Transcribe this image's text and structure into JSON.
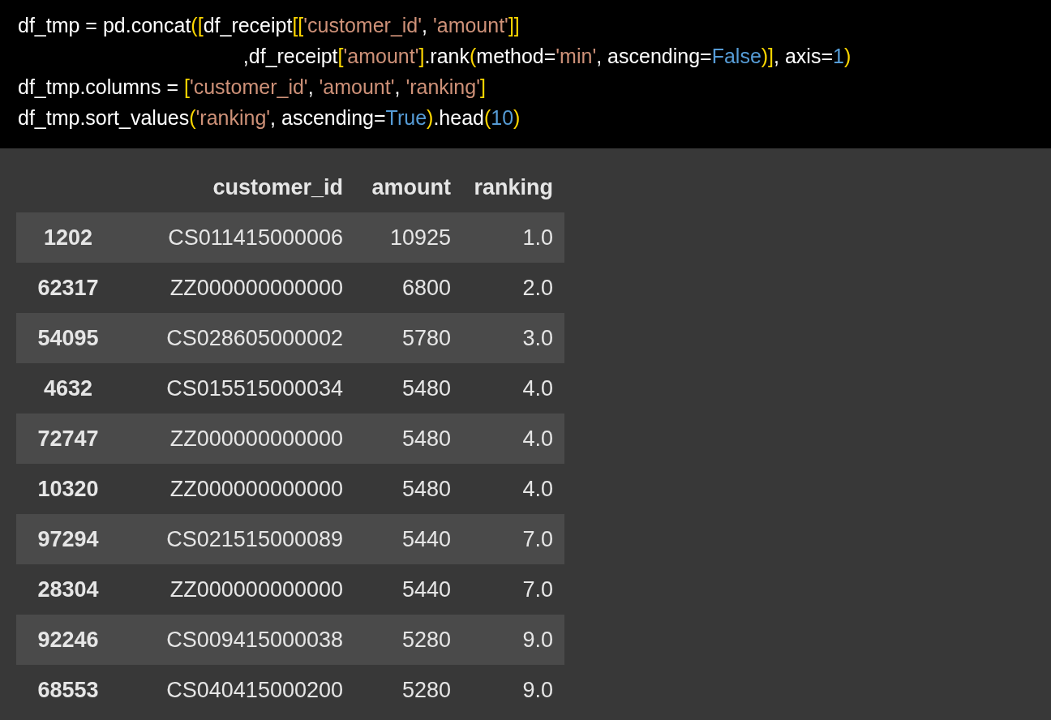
{
  "code_cell": {
    "lines": [
      {
        "tokens": [
          {
            "text": "df_tmp = pd.concat",
            "kind": "plain"
          },
          {
            "text": "([",
            "kind": "bracket"
          },
          {
            "text": "df_receipt",
            "kind": "plain"
          },
          {
            "text": "[[",
            "kind": "bracket"
          },
          {
            "text": "'customer_id'",
            "kind": "string"
          },
          {
            "text": ", ",
            "kind": "plain"
          },
          {
            "text": "'amount'",
            "kind": "string"
          },
          {
            "text": "]]",
            "kind": "bracket"
          }
        ]
      },
      {
        "tokens": [
          {
            "text": "                                        ,df_receipt",
            "kind": "plain"
          },
          {
            "text": "[",
            "kind": "bracket"
          },
          {
            "text": "'amount'",
            "kind": "string"
          },
          {
            "text": "]",
            "kind": "bracket"
          },
          {
            "text": ".rank",
            "kind": "plain"
          },
          {
            "text": "(",
            "kind": "bracket"
          },
          {
            "text": "method=",
            "kind": "plain"
          },
          {
            "text": "'min'",
            "kind": "string"
          },
          {
            "text": ", ascending=",
            "kind": "plain"
          },
          {
            "text": "False",
            "kind": "keyword"
          },
          {
            "text": ")]",
            "kind": "bracket"
          },
          {
            "text": ", axis=",
            "kind": "plain"
          },
          {
            "text": "1",
            "kind": "keyword"
          },
          {
            "text": ")",
            "kind": "bracket"
          }
        ]
      },
      {
        "tokens": [
          {
            "text": "df_tmp.columns = ",
            "kind": "plain"
          },
          {
            "text": "[",
            "kind": "bracket"
          },
          {
            "text": "'customer_id'",
            "kind": "string"
          },
          {
            "text": ", ",
            "kind": "plain"
          },
          {
            "text": "'amount'",
            "kind": "string"
          },
          {
            "text": ", ",
            "kind": "plain"
          },
          {
            "text": "'ranking'",
            "kind": "string"
          },
          {
            "text": "]",
            "kind": "bracket"
          }
        ]
      },
      {
        "tokens": [
          {
            "text": "df_tmp.sort_values",
            "kind": "plain"
          },
          {
            "text": "(",
            "kind": "bracket"
          },
          {
            "text": "'ranking'",
            "kind": "string"
          },
          {
            "text": ", ascending=",
            "kind": "plain"
          },
          {
            "text": "True",
            "kind": "keyword"
          },
          {
            "text": ")",
            "kind": "bracket"
          },
          {
            "text": ".head",
            "kind": "plain"
          },
          {
            "text": "(",
            "kind": "bracket"
          },
          {
            "text": "10",
            "kind": "keyword"
          },
          {
            "text": ")",
            "kind": "bracket"
          }
        ]
      }
    ]
  },
  "table": {
    "columns": [
      "customer_id",
      "amount",
      "ranking"
    ],
    "rows": [
      {
        "index": "1202",
        "cells": [
          "CS011415000006",
          "10925",
          "1.0"
        ]
      },
      {
        "index": "62317",
        "cells": [
          "ZZ000000000000",
          "6800",
          "2.0"
        ]
      },
      {
        "index": "54095",
        "cells": [
          "CS028605000002",
          "5780",
          "3.0"
        ]
      },
      {
        "index": "4632",
        "cells": [
          "CS015515000034",
          "5480",
          "4.0"
        ]
      },
      {
        "index": "72747",
        "cells": [
          "ZZ000000000000",
          "5480",
          "4.0"
        ]
      },
      {
        "index": "10320",
        "cells": [
          "ZZ000000000000",
          "5480",
          "4.0"
        ]
      },
      {
        "index": "97294",
        "cells": [
          "CS021515000089",
          "5440",
          "7.0"
        ]
      },
      {
        "index": "28304",
        "cells": [
          "ZZ000000000000",
          "5440",
          "7.0"
        ]
      },
      {
        "index": "92246",
        "cells": [
          "CS009415000038",
          "5280",
          "9.0"
        ]
      },
      {
        "index": "68553",
        "cells": [
          "CS040415000200",
          "5280",
          "9.0"
        ]
      }
    ]
  }
}
